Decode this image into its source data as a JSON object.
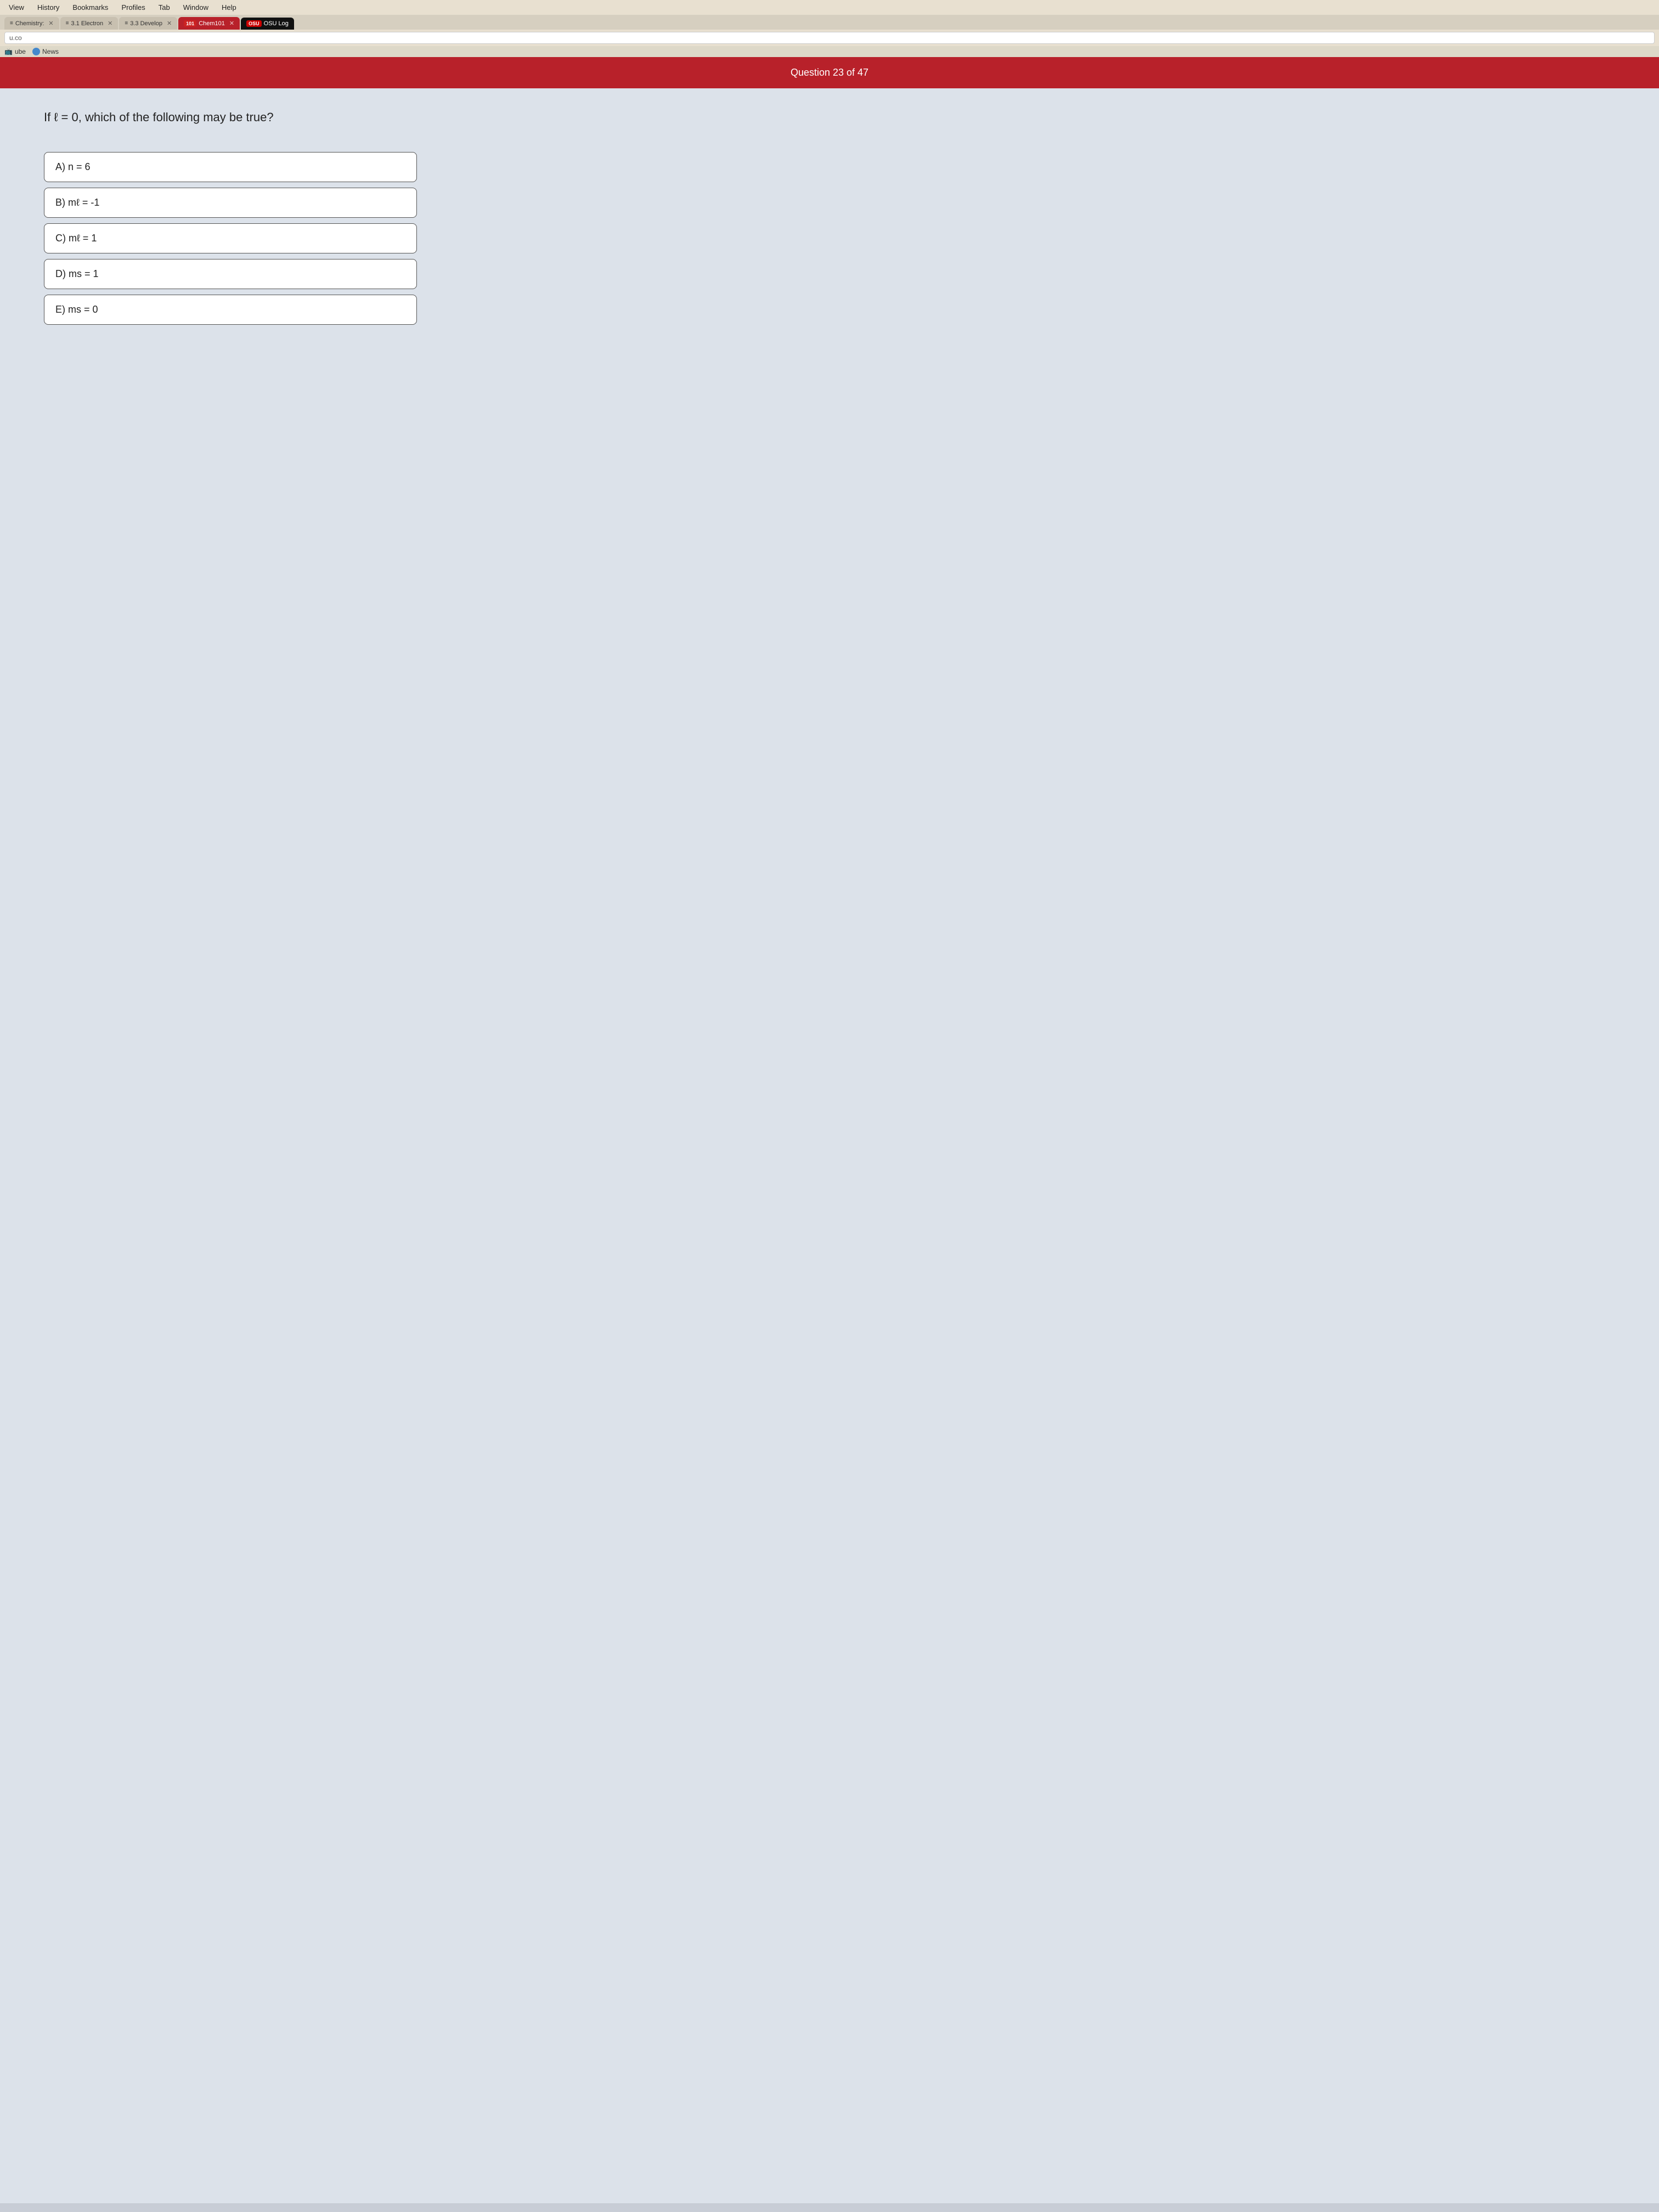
{
  "browser": {
    "menu": {
      "items": [
        "View",
        "History",
        "Bookmarks",
        "Profiles",
        "Tab",
        "Window",
        "Help"
      ]
    },
    "tabs": [
      {
        "id": "tab1",
        "label": "Chemistry:",
        "icon": "≡",
        "active": false
      },
      {
        "id": "tab2",
        "label": "3.1 Electron",
        "icon": "≡",
        "active": false
      },
      {
        "id": "tab3",
        "label": "3.3 Develop",
        "icon": "≡",
        "active": false
      },
      {
        "id": "tab4",
        "label": "Chem101",
        "icon": "101",
        "active": true,
        "special": "osu"
      },
      {
        "id": "tab5",
        "label": "OSU Log",
        "icon": "OSU",
        "active": false,
        "special": "osu-logo"
      }
    ],
    "address_bar": {
      "url": "u.co"
    },
    "bookmarks": [
      {
        "label": "ube",
        "icon": "📺"
      },
      {
        "label": "News",
        "icon": "🔵"
      }
    ]
  },
  "page": {
    "question_header": "Question 23 of 47",
    "question_text": "If ℓ = 0, which of the following may be true?",
    "answers": [
      {
        "id": "A",
        "label": "A) n = 6"
      },
      {
        "id": "B",
        "label": "B) mℓ = -1"
      },
      {
        "id": "C",
        "label": "C) mℓ = 1"
      },
      {
        "id": "D",
        "label": "D) ms = 1"
      },
      {
        "id": "E",
        "label": "E) ms = 0"
      }
    ]
  },
  "colors": {
    "header_red": "#b8212a",
    "tab_active": "#b8212a"
  }
}
